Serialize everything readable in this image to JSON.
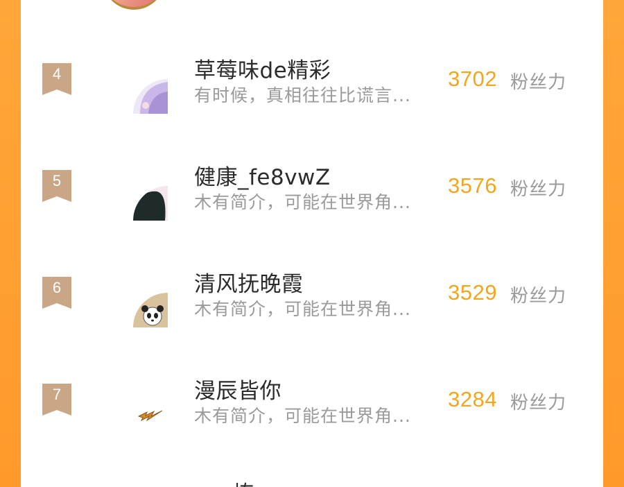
{
  "ranking": {
    "items": [
      {
        "rank": "4",
        "name": "草莓味de精彩",
        "bio": "有时候，真相往往比谎言...",
        "score": "3702",
        "score_label": "粉丝力",
        "avatar_icon": "anime-girl-avatar"
      },
      {
        "rank": "5",
        "name": "健康_fe8vwZ",
        "bio": "木有简介，可能在世界角...",
        "score": "3576",
        "score_label": "粉丝力",
        "avatar_icon": "dark-hair-avatar"
      },
      {
        "rank": "6",
        "name": "清风抚晚霞",
        "bio": "木有简介，可能在世界角...",
        "score": "3529",
        "score_label": "粉丝力",
        "avatar_icon": "panda-avatar"
      },
      {
        "rank": "7",
        "name": "漫辰皆你",
        "bio": "木有简介，可能在世界角...",
        "score": "3284",
        "score_label": "粉丝力",
        "avatar_icon": "lightning-avatar"
      }
    ],
    "partial_next_name": "yoy炼"
  },
  "colors": {
    "background": "#FFA63A",
    "badge": "#C9A685",
    "score": "#F3A51F",
    "name": "#2B2B2B",
    "muted": "#9A9A9A"
  }
}
